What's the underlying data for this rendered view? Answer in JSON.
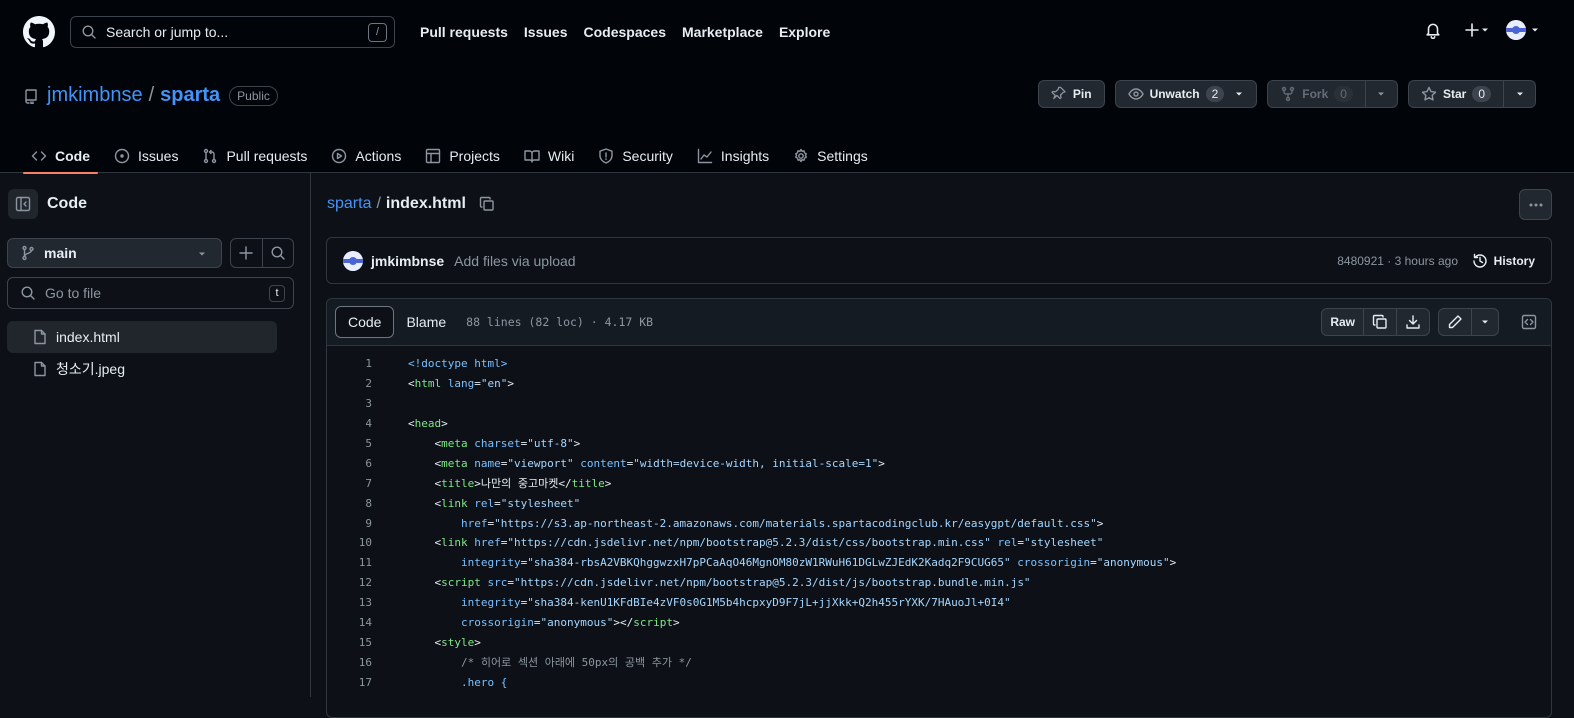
{
  "header": {
    "search_placeholder": "Search or jump to...",
    "search_key": "/",
    "nav": [
      "Pull requests",
      "Issues",
      "Codespaces",
      "Marketplace",
      "Explore"
    ]
  },
  "repo": {
    "owner": "jmkimbnse",
    "name": "sparta",
    "visibility": "Public",
    "pin_label": "Pin",
    "unwatch_label": "Unwatch",
    "watch_count": "2",
    "fork_label": "Fork",
    "fork_count": "0",
    "star_label": "Star",
    "star_count": "0",
    "tabs": [
      "Code",
      "Issues",
      "Pull requests",
      "Actions",
      "Projects",
      "Wiki",
      "Security",
      "Insights",
      "Settings"
    ]
  },
  "sidebar": {
    "title": "Code",
    "branch": "main",
    "goto_placeholder": "Go to file",
    "goto_key": "t",
    "files": [
      "index.html",
      "청소기.jpeg"
    ]
  },
  "file": {
    "repo": "sparta",
    "name": "index.html",
    "commit_author": "jmkimbnse",
    "commit_message": "Add files via upload",
    "commit_meta": "8480921 · 3 hours ago",
    "history_label": "History",
    "view_code": "Code",
    "view_blame": "Blame",
    "info": "88 lines (82 loc) · 4.17 KB",
    "raw_label": "Raw"
  },
  "code_lines": [
    "1",
    "2",
    "3",
    "4",
    "5",
    "6",
    "7",
    "8",
    "9",
    "10",
    "11",
    "12",
    "13",
    "14",
    "15",
    "16",
    "17"
  ],
  "code": {
    "l1": "<!doctype html>",
    "l2_tag": "html",
    "l2_attr": "lang",
    "l2_val": "\"en\"",
    "l4_tag": "head",
    "l5_tag": "meta",
    "l5_attr": "charset",
    "l5_val": "\"utf-8\"",
    "l6_tag": "meta",
    "l6_attr1": "name",
    "l6_val1": "\"viewport\"",
    "l6_attr2": "content",
    "l6_val2": "\"width=device-width, initial-scale=1\"",
    "l7_tag": "title",
    "l7_text": "나만의 중고마켓",
    "l7_close": "title",
    "l8_tag": "link",
    "l8_attr": "rel",
    "l8_val": "\"stylesheet\"",
    "l9_attr": "href",
    "l9_val": "\"https://s3.ap-northeast-2.amazonaws.com/materials.spartacodingclub.kr/easygpt/default.css\"",
    "l10_tag": "link",
    "l10_attr1": "href",
    "l10_val1": "\"https://cdn.jsdelivr.net/npm/bootstrap@5.2.3/dist/css/bootstrap.min.css\"",
    "l10_attr2": "rel",
    "l10_val2": "\"stylesheet\"",
    "l11_attr1": "integrity",
    "l11_val1": "\"sha384-rbsA2VBKQhggwzxH7pPCaAqO46MgnOM80zW1RWuH61DGLwZJEdK2Kadq2F9CUG65\"",
    "l11_attr2": "crossorigin",
    "l11_val2": "\"anonymous\"",
    "l12_tag": "script",
    "l12_attr": "src",
    "l12_val": "\"https://cdn.jsdelivr.net/npm/bootstrap@5.2.3/dist/js/bootstrap.bundle.min.js\"",
    "l13_attr": "integrity",
    "l13_val": "\"sha384-kenU1KFdBIe4zVF0s0G1M5b4hcpxyD9F7jL+jjXkk+Q2h455rYXK/7HAuoJl+0I4\"",
    "l14_attr": "crossorigin",
    "l14_val": "\"anonymous\"",
    "l14_close": "script",
    "l15_tag": "style",
    "l16": "/* 히어로 섹션 아래에 50px의 공백 추가 */",
    "l17": ".hero {"
  }
}
